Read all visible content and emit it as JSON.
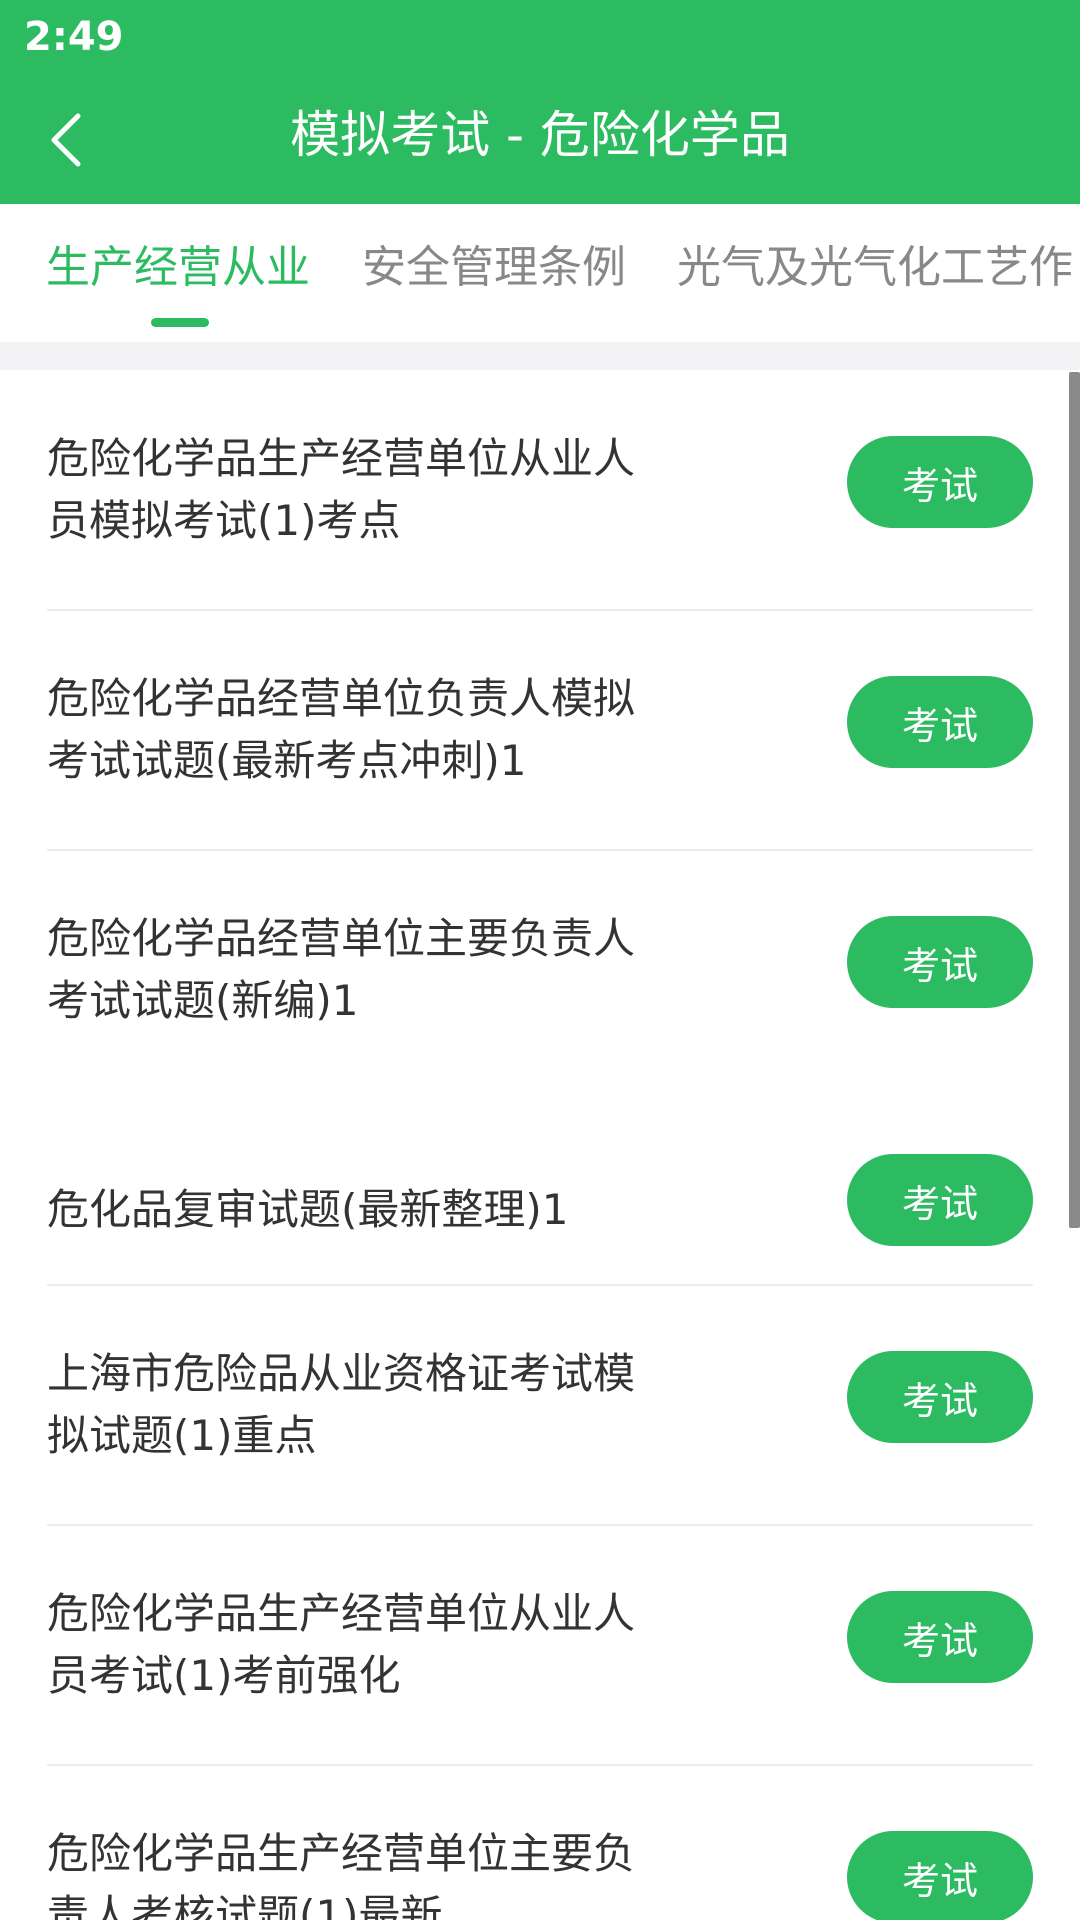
{
  "status_bar": {
    "time": "2:49"
  },
  "header": {
    "title": "模拟考试 - 危险化学品"
  },
  "tabs": [
    {
      "label": "生产经营从业",
      "active": true
    },
    {
      "label": "安全管理条例",
      "active": false
    },
    {
      "label": "光气及光气化工艺作",
      "active": false
    }
  ],
  "list": {
    "button_label": "考试",
    "items": [
      {
        "title": "危险化学品生产经营单位从业人员模拟考试(1)考点"
      },
      {
        "title": "危险化学品经营单位负责人模拟考试试题(最新考点冲刺)1"
      },
      {
        "title": "危险化学品经营单位主要负责人考试试题(新编)1"
      },
      {
        "title": "危化品复审试题(最新整理)1"
      },
      {
        "title": "上海市危险品从业资格证考试模拟试题(1)重点"
      },
      {
        "title": "危险化学品生产经营单位从业人员考试(1)考前强化"
      },
      {
        "title": "危险化学品生产经营单位主要负责人考核试题(1)最新"
      }
    ]
  },
  "colors": {
    "brand_green": "#2dbb62",
    "text_dark": "#333333",
    "text_gray": "#888888",
    "divider": "#ececec",
    "tab_strip_bg": "#f3f3f5"
  },
  "icons": {
    "back": "chevron-left-icon"
  }
}
